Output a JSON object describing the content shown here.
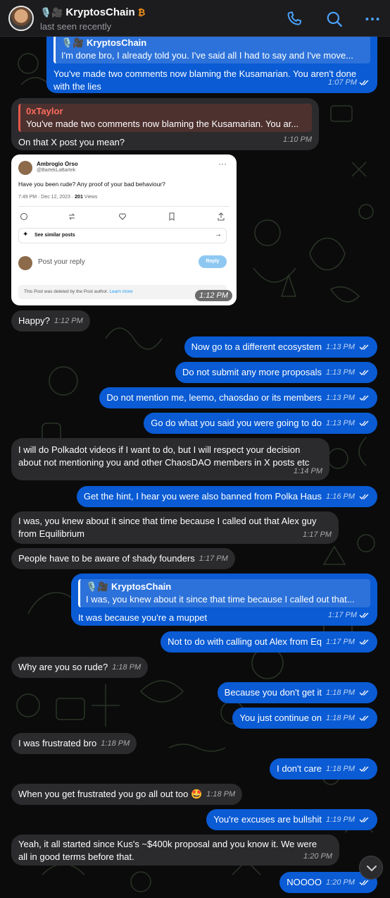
{
  "header": {
    "contact_emoji": "🎙️🎥",
    "contact_name": "KryptosChain",
    "status": "last seen recently",
    "icons": [
      "phone-icon",
      "search-icon",
      "more-icon"
    ]
  },
  "colors": {
    "outgoing": "#0a5bd4",
    "incoming": "#2b2b2d",
    "header": "#1c1c1e"
  },
  "messages": {
    "m1": {
      "reply_name": "KryptosChain",
      "reply_text": "I'm done bro, I already told you. I've said all I had to say and I've move...",
      "line1": "You've made two comments now blaming the Kusamarian. You aren't done",
      "line2": "with the lies",
      "time": "1:07 PM"
    },
    "m2": {
      "reply_name": "0xTaylor",
      "reply_text": "You've made two comments now blaming the Kusamarian. You ar...",
      "text": "On that X post you mean?",
      "time": "1:10 PM"
    },
    "shot": {
      "name": "Ambrogio Orso",
      "handle": "@BartekLaBartek",
      "post_text": "Have you been rude? Any proof of your bad behaviour?",
      "meta_prefix": "7:49 PM · Dec 12, 2023 · ",
      "views_count": "201",
      "views_label": " Views",
      "similar": "See similar posts",
      "reply_placeholder": "Post your reply",
      "reply_button": "Reply",
      "deleted_text": "This Post was deleted by the Post author. ",
      "learn_more": "Learn more",
      "time": "1:12 PM"
    },
    "m3": {
      "text": "Happy?",
      "time": "1:12 PM"
    },
    "m4": {
      "text": "Now go to a different ecosystem",
      "time": "1:13 PM"
    },
    "m5": {
      "text": "Do not submit any more proposals",
      "time": "1:13 PM"
    },
    "m6": {
      "text": "Do not mention me, leemo, chaosdao or its members",
      "time": "1:13 PM"
    },
    "m7": {
      "text": "Go do what you said you were going to do",
      "time": "1:13 PM"
    },
    "m8": {
      "line1": "I will do Polkadot videos if I want to do, but I will respect your decision",
      "line2": "about not mentioning you and other ChaosDAO members in X posts etc",
      "time": "1:14 PM"
    },
    "m9": {
      "text": "Get the hint, I hear you were also banned from Polka Haus",
      "time": "1:16 PM"
    },
    "m10": {
      "line1": "I was, you knew about it since that time because I called out that Alex guy",
      "line2": "from Equilibrium",
      "time": "1:17 PM"
    },
    "m11": {
      "text": "People have to be aware of shady founders",
      "time": "1:17 PM"
    },
    "m12": {
      "reply_name": "KryptosChain",
      "reply_text": "I was, you knew about it since that time because I called out that...",
      "text": "It was because you're a muppet",
      "time": "1:17 PM"
    },
    "m13": {
      "text": "Not to do with calling out Alex from Eq",
      "time": "1:17 PM"
    },
    "m14": {
      "text": "Why are you so rude?",
      "time": "1:18 PM"
    },
    "m15": {
      "text": "Because you don't get it",
      "time": "1:18 PM"
    },
    "m16": {
      "text": "You just continue on",
      "time": "1:18 PM"
    },
    "m17": {
      "text": "I was frustrated bro",
      "time": "1:18 PM"
    },
    "m18": {
      "text": "I don't care",
      "time": "1:18 PM"
    },
    "m19": {
      "text": "When you get frustrated you go all out too 🤩",
      "time": "1:18 PM"
    },
    "m20": {
      "text": "You're excuses are bullshit",
      "time": "1:19 PM"
    },
    "m21": {
      "line1": "Yeah, it all started since Kus's ~$400k proposal and you know it. We were",
      "line2": "all in good terms before that.",
      "time": "1:20 PM"
    },
    "m22": {
      "text": "NOOOO",
      "time": "1:20 PM"
    }
  }
}
